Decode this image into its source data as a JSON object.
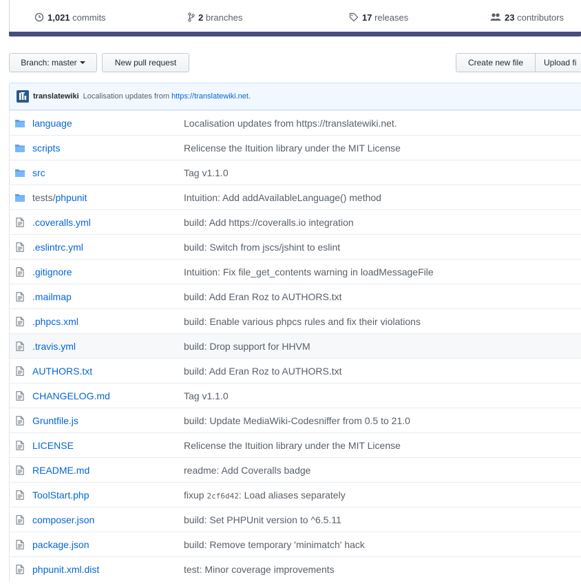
{
  "stats": {
    "commits": {
      "count": "1,021",
      "label": "commits",
      "icon": "history-icon"
    },
    "branches": {
      "count": "2",
      "label": "branches",
      "icon": "git-branch-icon"
    },
    "releases": {
      "count": "17",
      "label": "releases",
      "icon": "tag-icon"
    },
    "contributors": {
      "count": "23",
      "label": "contributors",
      "icon": "people-icon"
    },
    "language_bar_color": "#474d7d"
  },
  "toolbar": {
    "branch_label": "Branch:",
    "branch_value": "master",
    "new_pull_request": "New pull request",
    "create_new_file": "Create new file",
    "upload_files": "Upload fi"
  },
  "latest_commit": {
    "author": "translatewiki",
    "message_prefix": "Localisation updates from",
    "link": "https://translatewiki.net",
    "message_suffix": "."
  },
  "files": [
    {
      "type": "dir",
      "name": "language",
      "message": "Localisation updates from https://translatewiki.net."
    },
    {
      "type": "dir",
      "name": "scripts",
      "message": "Relicense the Ituition library under the MIT License"
    },
    {
      "type": "dir",
      "name": "src",
      "message": "Tag v1.1.0"
    },
    {
      "type": "dir",
      "name_prefix": "tests/",
      "name": "phpunit",
      "message": "Intuition: Add addAvailableLanguage() method"
    },
    {
      "type": "file",
      "name": ".coveralls.yml",
      "message": "build: Add https://coveralls.io integration"
    },
    {
      "type": "file",
      "name": ".eslintrc.yml",
      "message": "build: Switch from jscs/jshint to eslint"
    },
    {
      "type": "file",
      "name": ".gitignore",
      "message": "Intuition: Fix file_get_contents warning in loadMessageFile"
    },
    {
      "type": "file",
      "name": ".mailmap",
      "message": "build: Add Eran Roz to AUTHORS.txt"
    },
    {
      "type": "file",
      "name": ".phpcs.xml",
      "message": "build: Enable various phpcs rules and fix their violations"
    },
    {
      "type": "file",
      "name": ".travis.yml",
      "message": "build: Drop support for HHVM",
      "highlighted": true
    },
    {
      "type": "file",
      "name": "AUTHORS.txt",
      "message": "build: Add Eran Roz to AUTHORS.txt"
    },
    {
      "type": "file",
      "name": "CHANGELOG.md",
      "message": "Tag v1.1.0"
    },
    {
      "type": "file",
      "name": "Gruntfile.js",
      "message": "build: Update MediaWiki-Codesniffer from 0.5 to 21.0"
    },
    {
      "type": "file",
      "name": "LICENSE",
      "message": "Relicense the Ituition library under the MIT License"
    },
    {
      "type": "file",
      "name": "README.md",
      "message": "readme: Add Coveralls badge"
    },
    {
      "type": "file",
      "name": "ToolStart.php",
      "message_prefix": "fixup",
      "message_code": "2cf6d42",
      "message": ": Load aliases separately"
    },
    {
      "type": "file",
      "name": "composer.json",
      "message": "build: Set PHPUnit version to ^6.5.11"
    },
    {
      "type": "file",
      "name": "package.json",
      "message": "build: Remove temporary 'minimatch' hack"
    },
    {
      "type": "file",
      "name": "phpunit.xml.dist",
      "message": "test: Minor coverage improvements"
    }
  ]
}
